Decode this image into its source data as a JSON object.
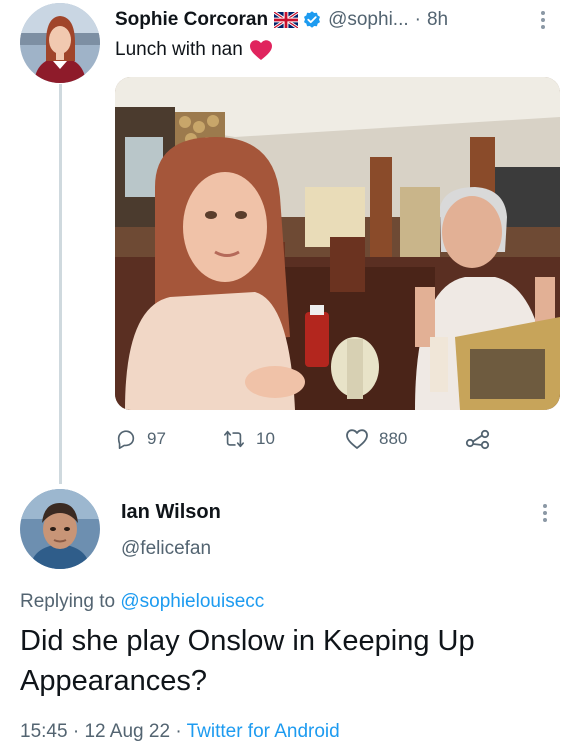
{
  "original_tweet": {
    "author_name": "Sophie Corcoran",
    "author_handle": "@sophi...",
    "separator": "·",
    "time": "8h",
    "text": "Lunch with nan",
    "flag_icon": "uk-flag-icon",
    "verified_icon": "verified-badge-icon",
    "heart_icon": "red-heart-icon",
    "actions": {
      "replies": "97",
      "retweets": "10",
      "likes": "880"
    }
  },
  "reply_tweet": {
    "author_name": "Ian Wilson",
    "author_handle": "@felicefan",
    "replying_prefix": "Replying to",
    "replying_to": "@sophielouisecc",
    "text": "Did she play Onslow in Keeping Up Appearances?",
    "time": "15:45",
    "date": "12 Aug 22",
    "separator": "·",
    "source": "Twitter for Android"
  },
  "colors": {
    "text_primary": "#0f1419",
    "text_secondary": "#536471",
    "link": "#1d9bf0",
    "verified": "#1d9bf0",
    "heart": "#e0245e",
    "thread_line": "#cfd9de"
  }
}
